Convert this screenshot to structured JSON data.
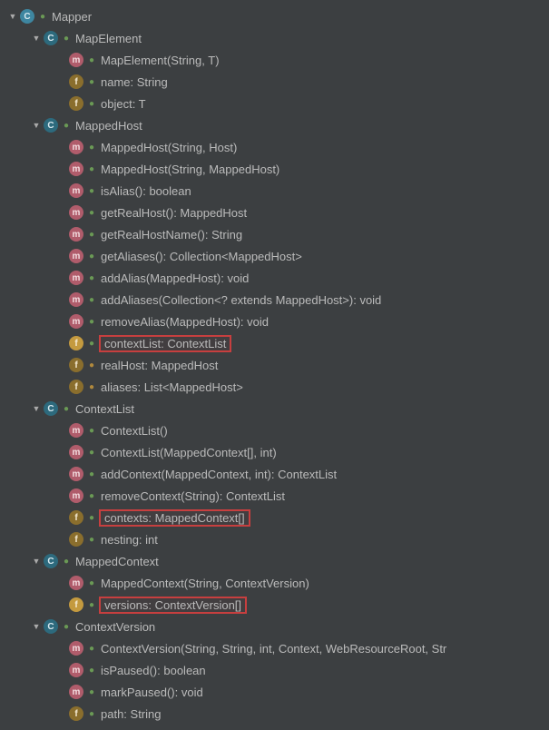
{
  "tree": [
    {
      "depth": 0,
      "arrow": "down",
      "icon": "class",
      "vis": "public",
      "label": "Mapper"
    },
    {
      "depth": 1,
      "arrow": "down",
      "icon": "classf",
      "vis": "public",
      "label": "MapElement"
    },
    {
      "depth": 2,
      "arrow": "none",
      "icon": "method",
      "vis": "public",
      "label": "MapElement(String, T)"
    },
    {
      "depth": 2,
      "arrow": "none",
      "icon": "fieldf",
      "vis": "public",
      "label": "name: String"
    },
    {
      "depth": 2,
      "arrow": "none",
      "icon": "fieldf",
      "vis": "public",
      "label": "object: T"
    },
    {
      "depth": 1,
      "arrow": "down",
      "icon": "classf",
      "vis": "public",
      "label": "MappedHost"
    },
    {
      "depth": 2,
      "arrow": "none",
      "icon": "method",
      "vis": "public",
      "label": "MappedHost(String, Host)"
    },
    {
      "depth": 2,
      "arrow": "none",
      "icon": "method",
      "vis": "public",
      "label": "MappedHost(String, MappedHost)"
    },
    {
      "depth": 2,
      "arrow": "none",
      "icon": "method",
      "vis": "public",
      "label": "isAlias(): boolean"
    },
    {
      "depth": 2,
      "arrow": "none",
      "icon": "method",
      "vis": "public",
      "label": "getRealHost(): MappedHost"
    },
    {
      "depth": 2,
      "arrow": "none",
      "icon": "method",
      "vis": "public",
      "label": "getRealHostName(): String"
    },
    {
      "depth": 2,
      "arrow": "none",
      "icon": "method",
      "vis": "public",
      "label": "getAliases(): Collection<MappedHost>"
    },
    {
      "depth": 2,
      "arrow": "none",
      "icon": "method",
      "vis": "public",
      "label": "addAlias(MappedHost): void"
    },
    {
      "depth": 2,
      "arrow": "none",
      "icon": "method",
      "vis": "public",
      "label": "addAliases(Collection<? extends MappedHost>): void"
    },
    {
      "depth": 2,
      "arrow": "none",
      "icon": "method",
      "vis": "public",
      "label": "removeAlias(MappedHost): void"
    },
    {
      "depth": 2,
      "arrow": "none",
      "icon": "field",
      "vis": "public",
      "label": "contextList: ContextList",
      "highlight": true
    },
    {
      "depth": 2,
      "arrow": "none",
      "icon": "fieldf",
      "vis": "protected",
      "label": "realHost: MappedHost"
    },
    {
      "depth": 2,
      "arrow": "none",
      "icon": "fieldf",
      "vis": "protected",
      "label": "aliases: List<MappedHost>"
    },
    {
      "depth": 1,
      "arrow": "down",
      "icon": "classf",
      "vis": "public",
      "label": "ContextList"
    },
    {
      "depth": 2,
      "arrow": "none",
      "icon": "method",
      "vis": "public",
      "label": "ContextList()"
    },
    {
      "depth": 2,
      "arrow": "none",
      "icon": "method",
      "vis": "public",
      "label": "ContextList(MappedContext[], int)"
    },
    {
      "depth": 2,
      "arrow": "none",
      "icon": "method",
      "vis": "public",
      "label": "addContext(MappedContext, int): ContextList"
    },
    {
      "depth": 2,
      "arrow": "none",
      "icon": "method",
      "vis": "public",
      "label": "removeContext(String): ContextList"
    },
    {
      "depth": 2,
      "arrow": "none",
      "icon": "fieldf",
      "vis": "public",
      "label": "contexts: MappedContext[]",
      "highlight": true
    },
    {
      "depth": 2,
      "arrow": "none",
      "icon": "fieldf",
      "vis": "public",
      "label": "nesting: int"
    },
    {
      "depth": 1,
      "arrow": "down",
      "icon": "classf",
      "vis": "public",
      "label": "MappedContext"
    },
    {
      "depth": 2,
      "arrow": "none",
      "icon": "method",
      "vis": "public",
      "label": "MappedContext(String, ContextVersion)"
    },
    {
      "depth": 2,
      "arrow": "none",
      "icon": "field",
      "vis": "public",
      "label": "versions: ContextVersion[]",
      "highlight": true
    },
    {
      "depth": 1,
      "arrow": "down",
      "icon": "classf",
      "vis": "public",
      "label": "ContextVersion"
    },
    {
      "depth": 2,
      "arrow": "none",
      "icon": "method",
      "vis": "public",
      "label": "ContextVersion(String, String, int, Context, WebResourceRoot, Str"
    },
    {
      "depth": 2,
      "arrow": "none",
      "icon": "method",
      "vis": "public",
      "label": "isPaused(): boolean"
    },
    {
      "depth": 2,
      "arrow": "none",
      "icon": "method",
      "vis": "public",
      "label": "markPaused(): void"
    },
    {
      "depth": 2,
      "arrow": "none",
      "icon": "fieldf",
      "vis": "public",
      "label": "path: String"
    }
  ],
  "icons": {
    "class": "C",
    "classf": "C",
    "method": "m",
    "field": "f",
    "fieldf": "f"
  },
  "arrows": {
    "down": "▼",
    "right": "▶"
  },
  "visibility": {
    "public": "●",
    "protected": "●",
    "package": "○"
  }
}
